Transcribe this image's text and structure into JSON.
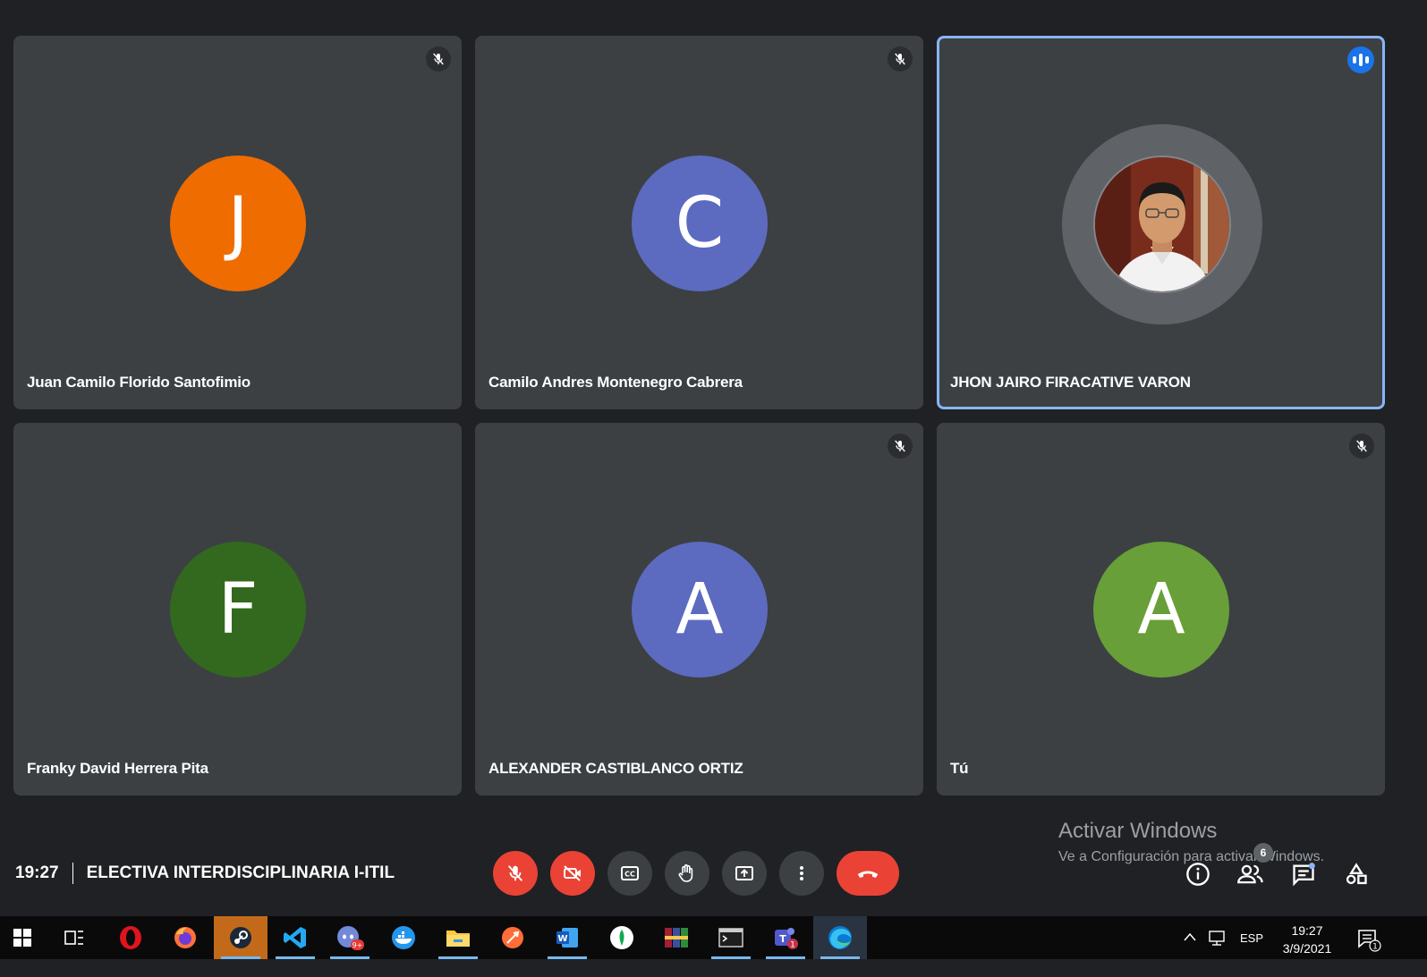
{
  "participants": [
    {
      "name": "Juan Camilo Florido Santofimio",
      "initial": "J",
      "color": "#ef6c00",
      "muted": true
    },
    {
      "name": "Camilo Andres Montenegro Cabrera",
      "initial": "C",
      "color": "#5c6bc0",
      "muted": true
    },
    {
      "name": "JHON JAIRO FIRACATIVE VARON",
      "initial": "",
      "color": "#5f6368",
      "muted": false,
      "speaking": true
    },
    {
      "name": "Franky David Herrera Pita",
      "initial": "F",
      "color": "#33691e",
      "muted": false
    },
    {
      "name": "ALEXANDER CASTIBLANCO ORTIZ",
      "initial": "A",
      "color": "#5c6bc0",
      "muted": true
    },
    {
      "name": "Tú",
      "initial": "A",
      "color": "#689f38",
      "muted": true
    }
  ],
  "meeting": {
    "time": "19:27",
    "title": "ELECTIVA INTERDISCIPLINARIA I-ITIL"
  },
  "controls": [
    "mic-off",
    "camera-off",
    "captions",
    "raise-hand",
    "present",
    "more",
    "leave-call"
  ],
  "side_controls": {
    "people_count": "6"
  },
  "watermark": {
    "line1": "Activar Windows",
    "line2": "Ve a Configuración para activar Windows."
  },
  "taskbar": {
    "apps": [
      "start",
      "task-view",
      "opera",
      "firefox",
      "steam",
      "vscode",
      "discord",
      "docker",
      "file-explorer",
      "postman",
      "word",
      "mongodb",
      "winrar",
      "terminal",
      "teams",
      "edge"
    ],
    "discord_badge": "9+",
    "teams_badge": "1",
    "language": "ESP",
    "time": "19:27",
    "date": "3/9/2021",
    "notification_count": "1"
  }
}
